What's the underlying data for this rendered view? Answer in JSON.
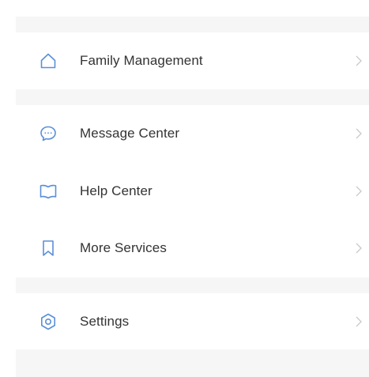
{
  "colors": {
    "accent": "#5b8fd9",
    "chevron": "#c9c9c9",
    "text": "#333333",
    "divider_bg": "#f6f6f7"
  },
  "menu": {
    "family_management": {
      "label": "Family Management",
      "icon": "home-icon"
    },
    "message_center": {
      "label": "Message Center",
      "icon": "chat-bubble-icon"
    },
    "help_center": {
      "label": "Help Center",
      "icon": "book-icon"
    },
    "more_services": {
      "label": "More Services",
      "icon": "bookmark-icon"
    },
    "settings": {
      "label": "Settings",
      "icon": "settings-icon"
    }
  }
}
